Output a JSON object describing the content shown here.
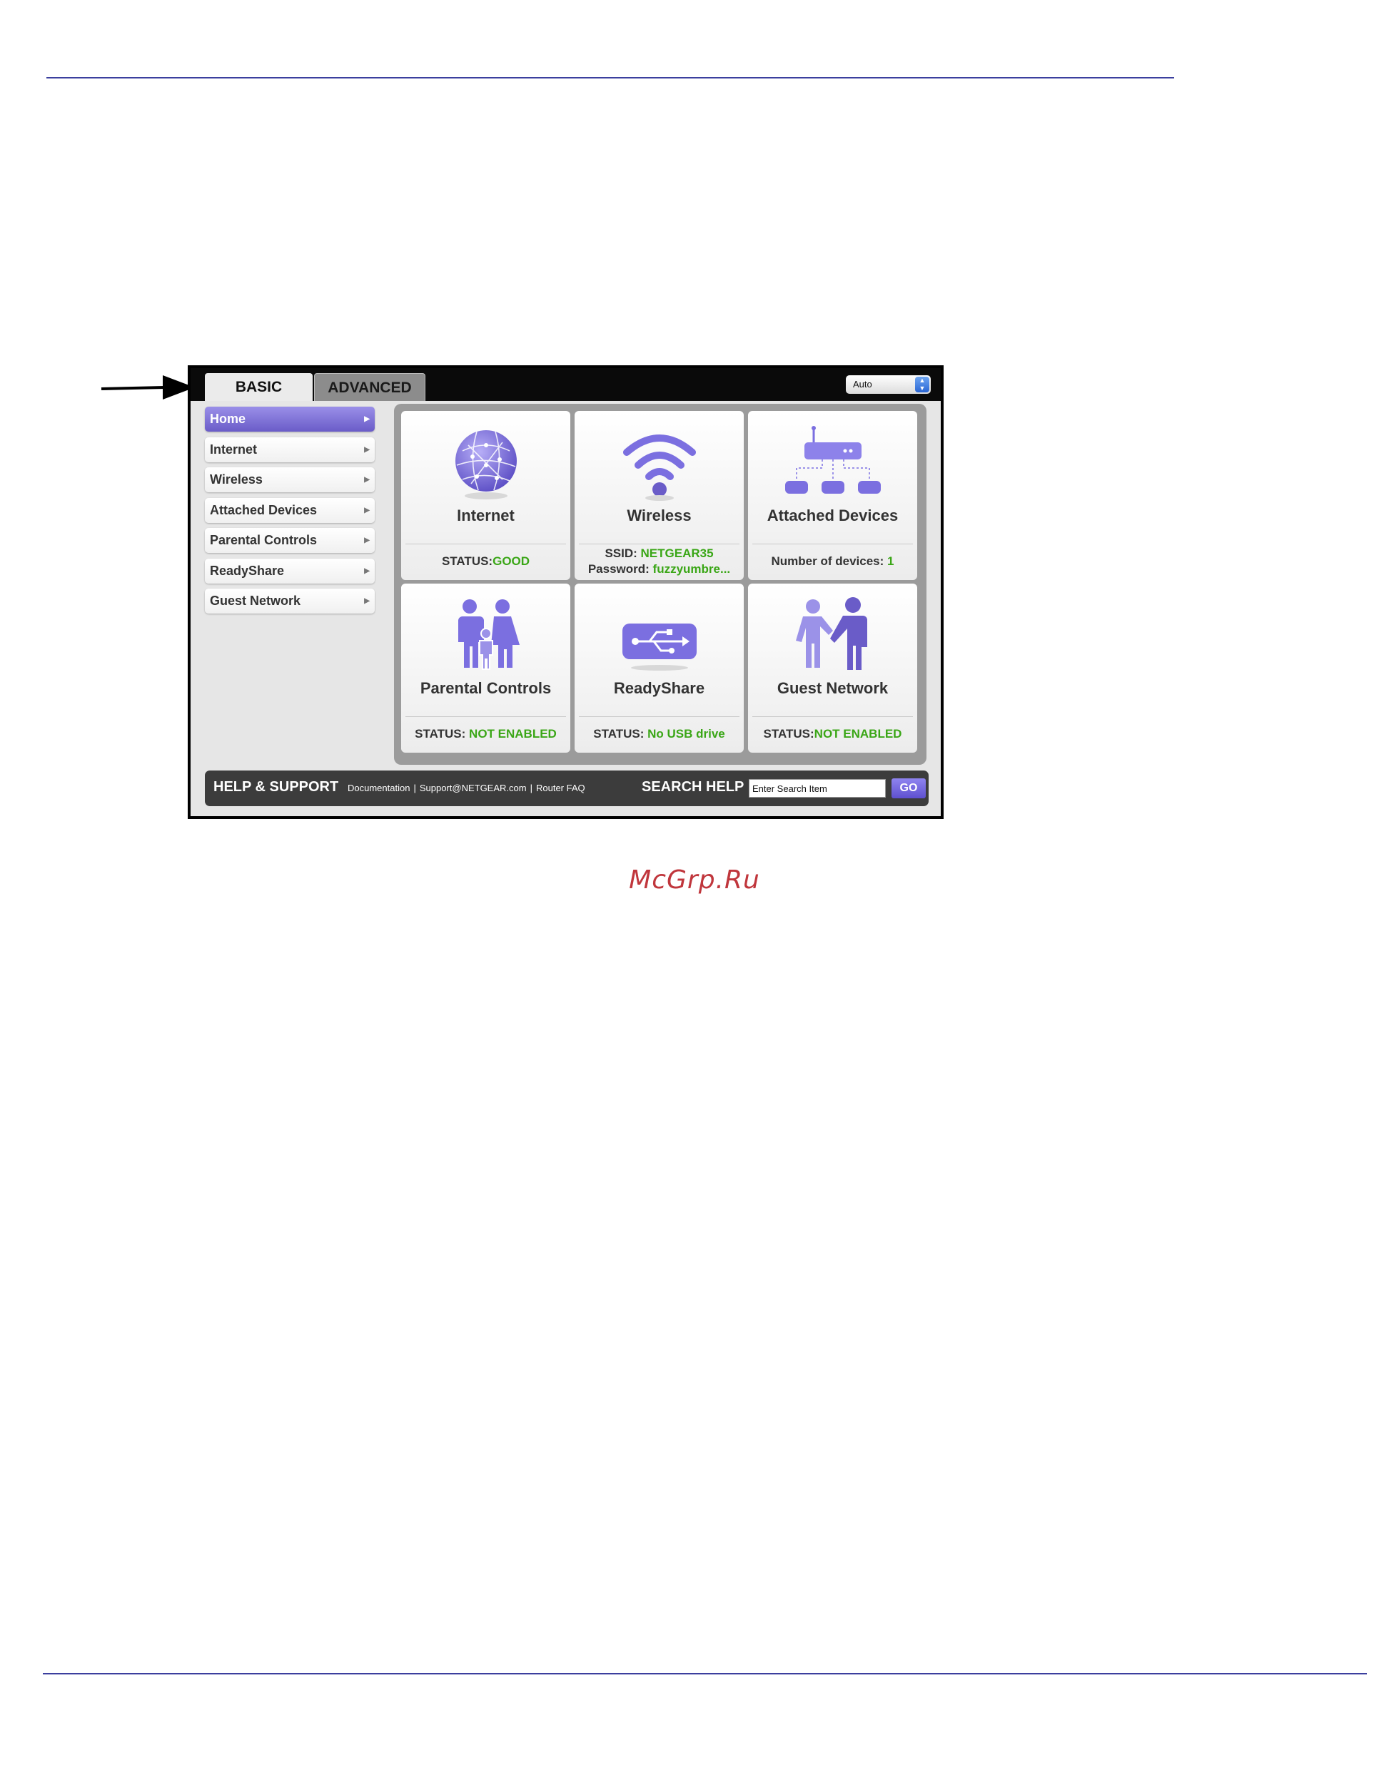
{
  "tabs": {
    "basic": "BASIC",
    "advanced": "ADVANCED"
  },
  "language_select": {
    "value": "Auto"
  },
  "sidebar": {
    "items": [
      {
        "label": "Home",
        "active": true
      },
      {
        "label": "Internet"
      },
      {
        "label": "Wireless"
      },
      {
        "label": "Attached Devices"
      },
      {
        "label": "Parental Controls"
      },
      {
        "label": "ReadyShare"
      },
      {
        "label": "Guest Network"
      }
    ]
  },
  "cards": {
    "internet": {
      "title": "Internet",
      "status_label": "STATUS:",
      "status_value": "GOOD",
      "icon": "globe-icon"
    },
    "wireless": {
      "title": "Wireless",
      "ssid_label": "SSID: ",
      "ssid_value": "NETGEAR35",
      "password_label": "Password: ",
      "password_value": "fuzzyumbre...",
      "icon": "wifi-icon"
    },
    "devices": {
      "title": "Attached Devices",
      "count_label": "Number of devices: ",
      "count_value": "1",
      "icon": "network-devices-icon"
    },
    "parental": {
      "title": "Parental Controls",
      "status_label": "STATUS: ",
      "status_value": "NOT ENABLED",
      "icon": "family-icon"
    },
    "readyshare": {
      "title": "ReadyShare",
      "status_label": "STATUS: ",
      "status_value": "No USB drive",
      "icon": "usb-icon"
    },
    "guest": {
      "title": "Guest Network",
      "status_label": "STATUS:",
      "status_value": "NOT ENABLED",
      "icon": "handshake-icon"
    }
  },
  "help": {
    "title": "HELP & SUPPORT",
    "links": [
      "Documentation",
      "Support@NETGEAR.com",
      "Router FAQ"
    ],
    "search_label": "SEARCH HELP",
    "search_placeholder": "Enter Search Item",
    "go_label": "GO"
  },
  "watermark": "McGrp.Ru",
  "colors": {
    "accent": "#7b6fe0",
    "status_green": "#3aa616",
    "rule": "#3b3f9e"
  }
}
